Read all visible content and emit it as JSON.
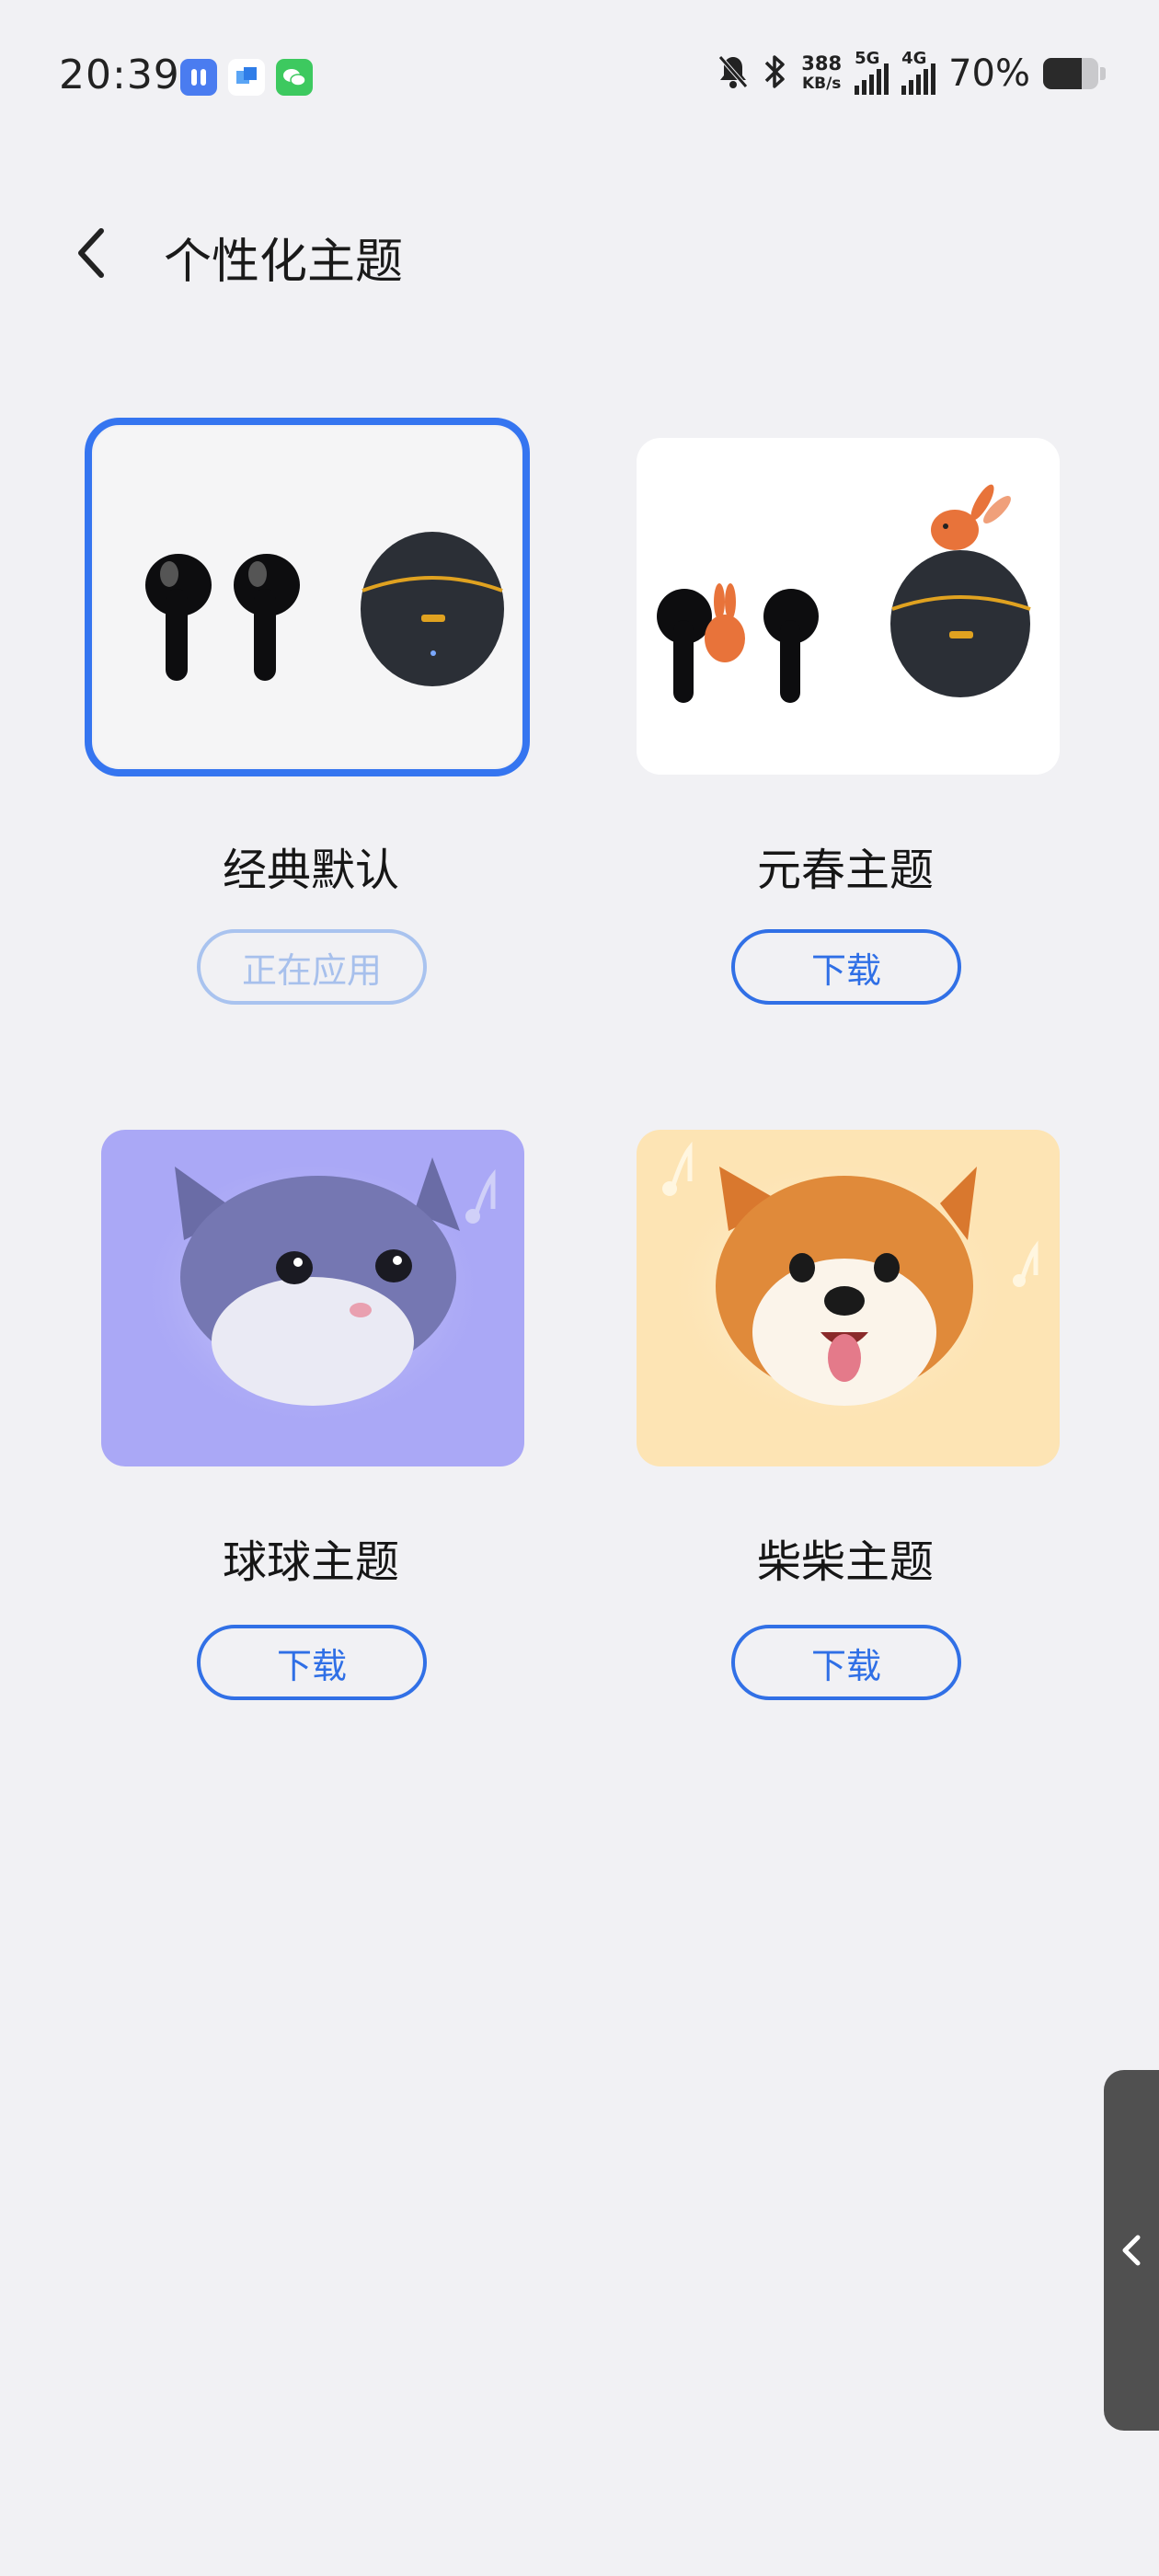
{
  "status_bar": {
    "time": "20:39",
    "net_speed_value": "388",
    "net_speed_unit": "KB/s",
    "sim1_label": "5G",
    "sim2_label": "4G",
    "battery_percent": "70%",
    "battery_level": 0.7,
    "icons": [
      "earbuds-app-icon",
      "files-app-icon",
      "wechat-icon",
      "bell-muted-icon",
      "bluetooth-icon",
      "signal-icon",
      "battery-icon"
    ]
  },
  "header": {
    "title": "个性化主题"
  },
  "themes": [
    {
      "name": "经典默认",
      "button": "正在应用",
      "selected": true
    },
    {
      "name": "元春主题",
      "button": "下载",
      "selected": false
    },
    {
      "name": "球球主题",
      "button": "下载",
      "selected": false
    },
    {
      "name": "柴柴主题",
      "button": "下载",
      "selected": false
    }
  ],
  "colors": {
    "accent": "#3170e6",
    "background": "#f1f1f4",
    "applied_button": "#a7c0ec"
  }
}
